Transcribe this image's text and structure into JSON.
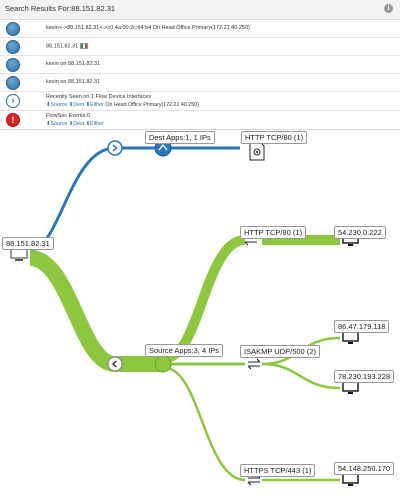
{
  "panel": {
    "title": "Search Results For:88.151.82.31",
    "info_icon": "i",
    "rows": [
      {
        "icon": "globe-icon",
        "text": "kevin<->88.151.82.31<->c0:4a:00:2c:d4:b4 On Head Office Primary(172.21.40.250)"
      },
      {
        "icon": "globe-icon",
        "text": "88.151.82.31"
      },
      {
        "icon": "user-icon",
        "text": "kevin on 88.151.82.31"
      },
      {
        "icon": "user-icon",
        "text": "kevin on 88.151.82.31"
      },
      {
        "icon": "chevron-right-icon",
        "text": "Recently Seen on 1 Flow Device Interfaces",
        "links": [
          "Source",
          "Dest",
          "Either"
        ],
        "extra": "On Head Office Primary(172.21.40.250)"
      },
      {
        "icon": "alert-icon",
        "text": "FlowSec Events:0",
        "links": [
          "Source",
          "Dest",
          "Either"
        ]
      }
    ]
  },
  "graph": {
    "root": "88.151.82.31",
    "dest_group": "Dest Apps:1, 1 IPs",
    "source_group": "Source Apps:3, 4 IPs",
    "dest_apps": [
      {
        "label": "HTTP TCP/80 (1)"
      }
    ],
    "source_apps": [
      {
        "label": "HTTP TCP/80 (1)",
        "ips": [
          "54.230.0.222"
        ]
      },
      {
        "label": "ISAKMP UDP/500 (2)",
        "ips": [
          "86.47.179.118",
          "78.230.193.228"
        ]
      },
      {
        "label": "HTTPS TCP/443 (1)",
        "ips": [
          "54.148.250.170"
        ]
      }
    ],
    "colors": {
      "dest_flow": "#2b78b8",
      "source_flow": "#8dc63f",
      "node_blue": "#2b78b8"
    },
    "dest_app_icon": "at-sign-document-icon",
    "ip_icon": "monitor-icon",
    "app_icon": "bidirectional-arrows-icon"
  }
}
